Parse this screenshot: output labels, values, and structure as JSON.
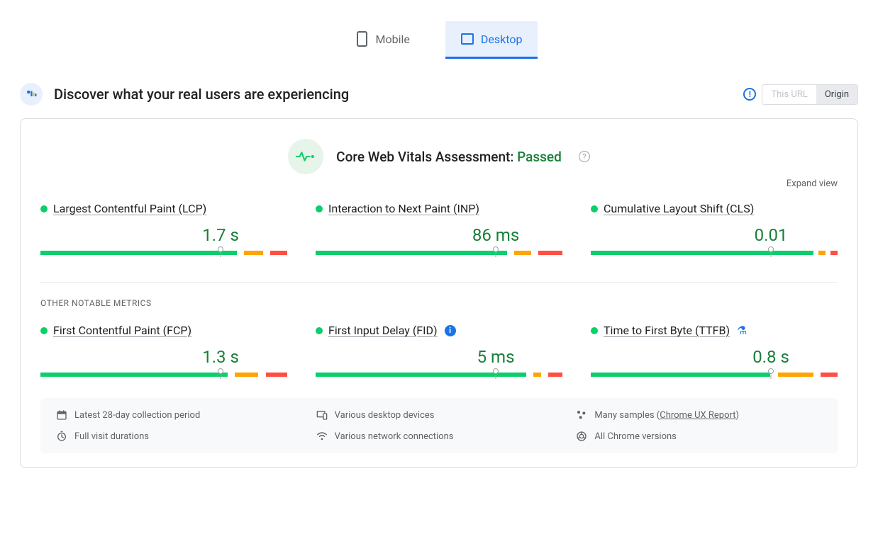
{
  "tabs": {
    "mobile": "Mobile",
    "desktop": "Desktop",
    "active": "desktop"
  },
  "header": {
    "title": "Discover what your real users are experiencing"
  },
  "toggle": {
    "url": "This URL",
    "origin": "Origin",
    "active": "origin"
  },
  "assessment": {
    "label": "Core Web Vitals Assessment:",
    "status": "Passed"
  },
  "expand": "Expand view",
  "sectionOther": "OTHER NOTABLE METRICS",
  "core": [
    {
      "name": "Largest Contentful Paint (LCP)",
      "value": "1.7 s",
      "marker": 73,
      "segs": [
        82,
        3,
        8,
        3,
        7
      ]
    },
    {
      "name": "Interaction to Next Paint (INP)",
      "value": "86 ms",
      "marker": 73,
      "segs": [
        80,
        3,
        7,
        3,
        10
      ]
    },
    {
      "name": "Cumulative Layout Shift (CLS)",
      "value": "0.01",
      "marker": 73,
      "segs": [
        92,
        2,
        3,
        2,
        3
      ]
    }
  ],
  "other": [
    {
      "name": "First Contentful Paint (FCP)",
      "value": "1.3 s",
      "marker": 73,
      "segs": [
        78,
        3,
        10,
        3,
        9
      ],
      "badge": null
    },
    {
      "name": "First Input Delay (FID)",
      "value": "5 ms",
      "marker": 73,
      "segs": [
        88,
        3,
        3,
        3,
        6
      ],
      "badge": "info"
    },
    {
      "name": "Time to First Byte (TTFB)",
      "value": "0.8 s",
      "marker": 73,
      "segs": [
        75,
        3,
        15,
        3,
        7
      ],
      "badge": "flask"
    }
  ],
  "footer": {
    "period": "Latest 28-day collection period",
    "devices": "Various desktop devices",
    "samples_prefix": "Many samples (",
    "samples_link": "Chrome UX Report",
    "samples_suffix": ")",
    "durations": "Full visit durations",
    "network": "Various network connections",
    "versions": "All Chrome versions"
  }
}
